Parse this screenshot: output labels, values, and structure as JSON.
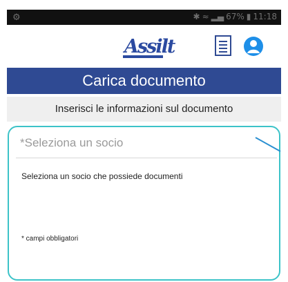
{
  "status_bar": {
    "left_icon": "android-debug-icon",
    "bluetooth_icon": "bluetooth-icon",
    "wifi_icon": "wifi-icon",
    "signal_icon": "signal-icon",
    "battery_percent": "67%",
    "battery_icon": "battery-icon",
    "time": "11:18"
  },
  "header": {
    "logo_text": "Assilt",
    "documents_icon": "document-list-icon",
    "profile_icon": "user-circle-icon"
  },
  "page": {
    "title": "Carica documento",
    "subtitle": "Inserisci le informazioni sul documento"
  },
  "form": {
    "partner_select": {
      "placeholder": "*Seleziona un socio"
    },
    "helper_text": "Seleziona un socio che possiede documenti",
    "required_note": "* campi obbligatori"
  },
  "colors": {
    "title_bar": "#2f4a93",
    "brand_blue": "#2b4aa0",
    "card_border": "#3cc3c8",
    "profile_icon": "#1e8fe8",
    "subtitle_bg": "#efefef"
  }
}
